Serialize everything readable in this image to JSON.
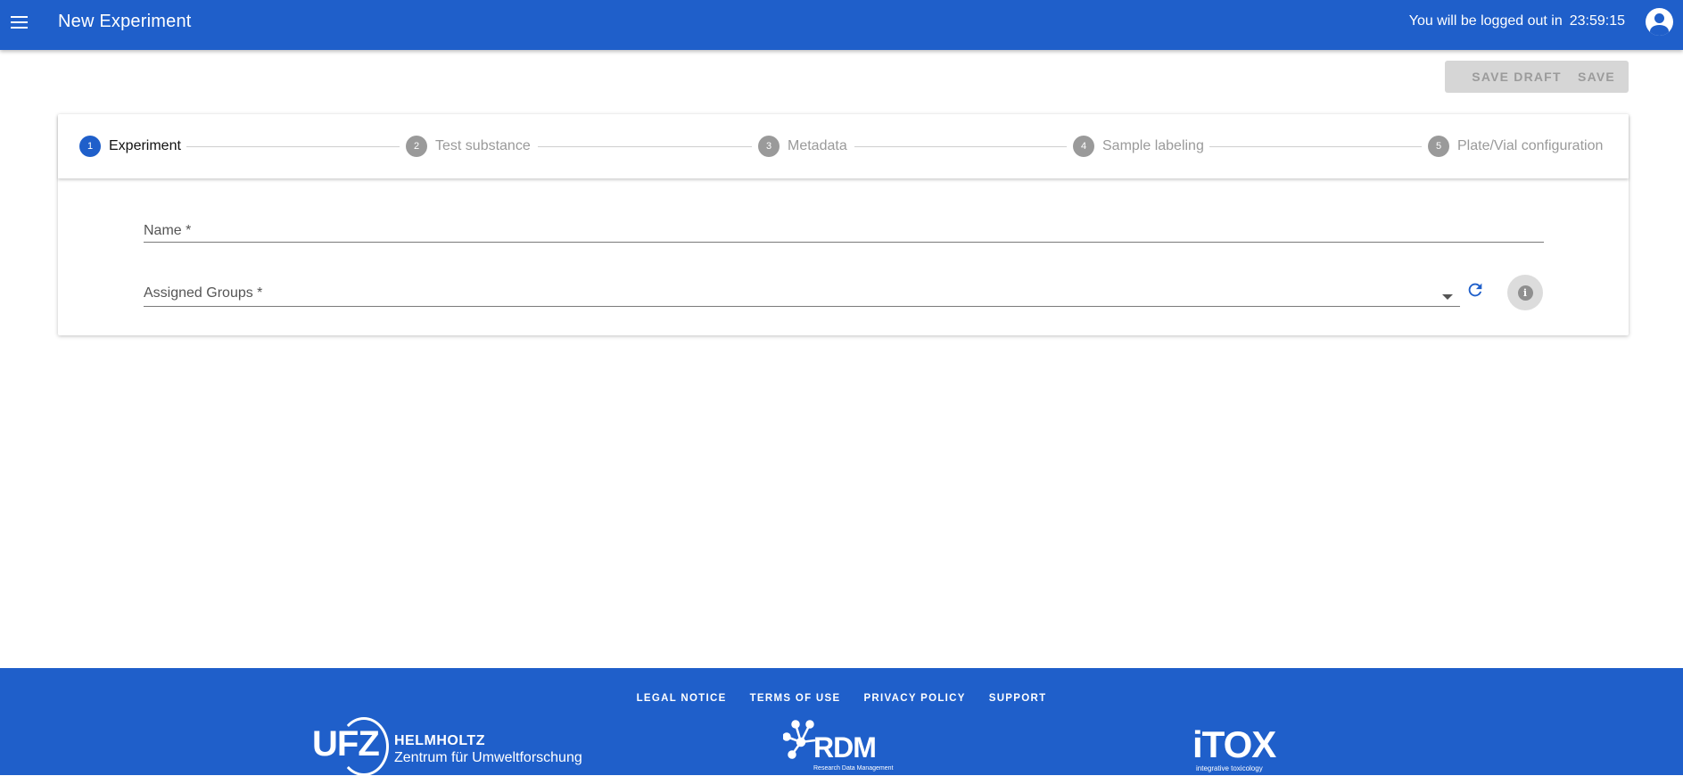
{
  "header": {
    "title": "New Experiment",
    "logout_label": "You will be logged out in",
    "logout_timer": "23:59:15"
  },
  "actions": {
    "save_draft_label": "SAVE DRAFT",
    "save_label": "SAVE"
  },
  "stepper": {
    "steps": [
      {
        "number": "1",
        "label": "Experiment",
        "active": true
      },
      {
        "number": "2",
        "label": "Test substance",
        "active": false
      },
      {
        "number": "3",
        "label": "Metadata",
        "active": false
      },
      {
        "number": "4",
        "label": "Sample labeling",
        "active": false
      },
      {
        "number": "5",
        "label": "Plate/Vial configuration",
        "active": false
      }
    ]
  },
  "form": {
    "name_label": "Name *",
    "name_value": "",
    "groups_label": "Assigned Groups *",
    "groups_value": "",
    "info_icon_text": "i"
  },
  "footer": {
    "links": [
      "LEGAL NOTICE",
      "TERMS OF USE",
      "PRIVACY POLICY",
      "SUPPORT"
    ],
    "ufz": {
      "mark": "UFZ",
      "line1": "HELMHOLTZ",
      "line2": "Zentrum für Umweltforschung"
    },
    "rdm": {
      "mark": "RDM",
      "sub": "Research Data Management"
    },
    "itox": {
      "mark": "iTOX",
      "sub": "integrative toxicology"
    }
  },
  "colors": {
    "primary": "#1f5fca",
    "disabled_button": "#d6d6d6",
    "inactive_step": "#9a9a9a"
  },
  "icons": [
    "menu-icon",
    "account-circle-icon",
    "dropdown-arrow-icon",
    "refresh-icon",
    "info-icon"
  ]
}
